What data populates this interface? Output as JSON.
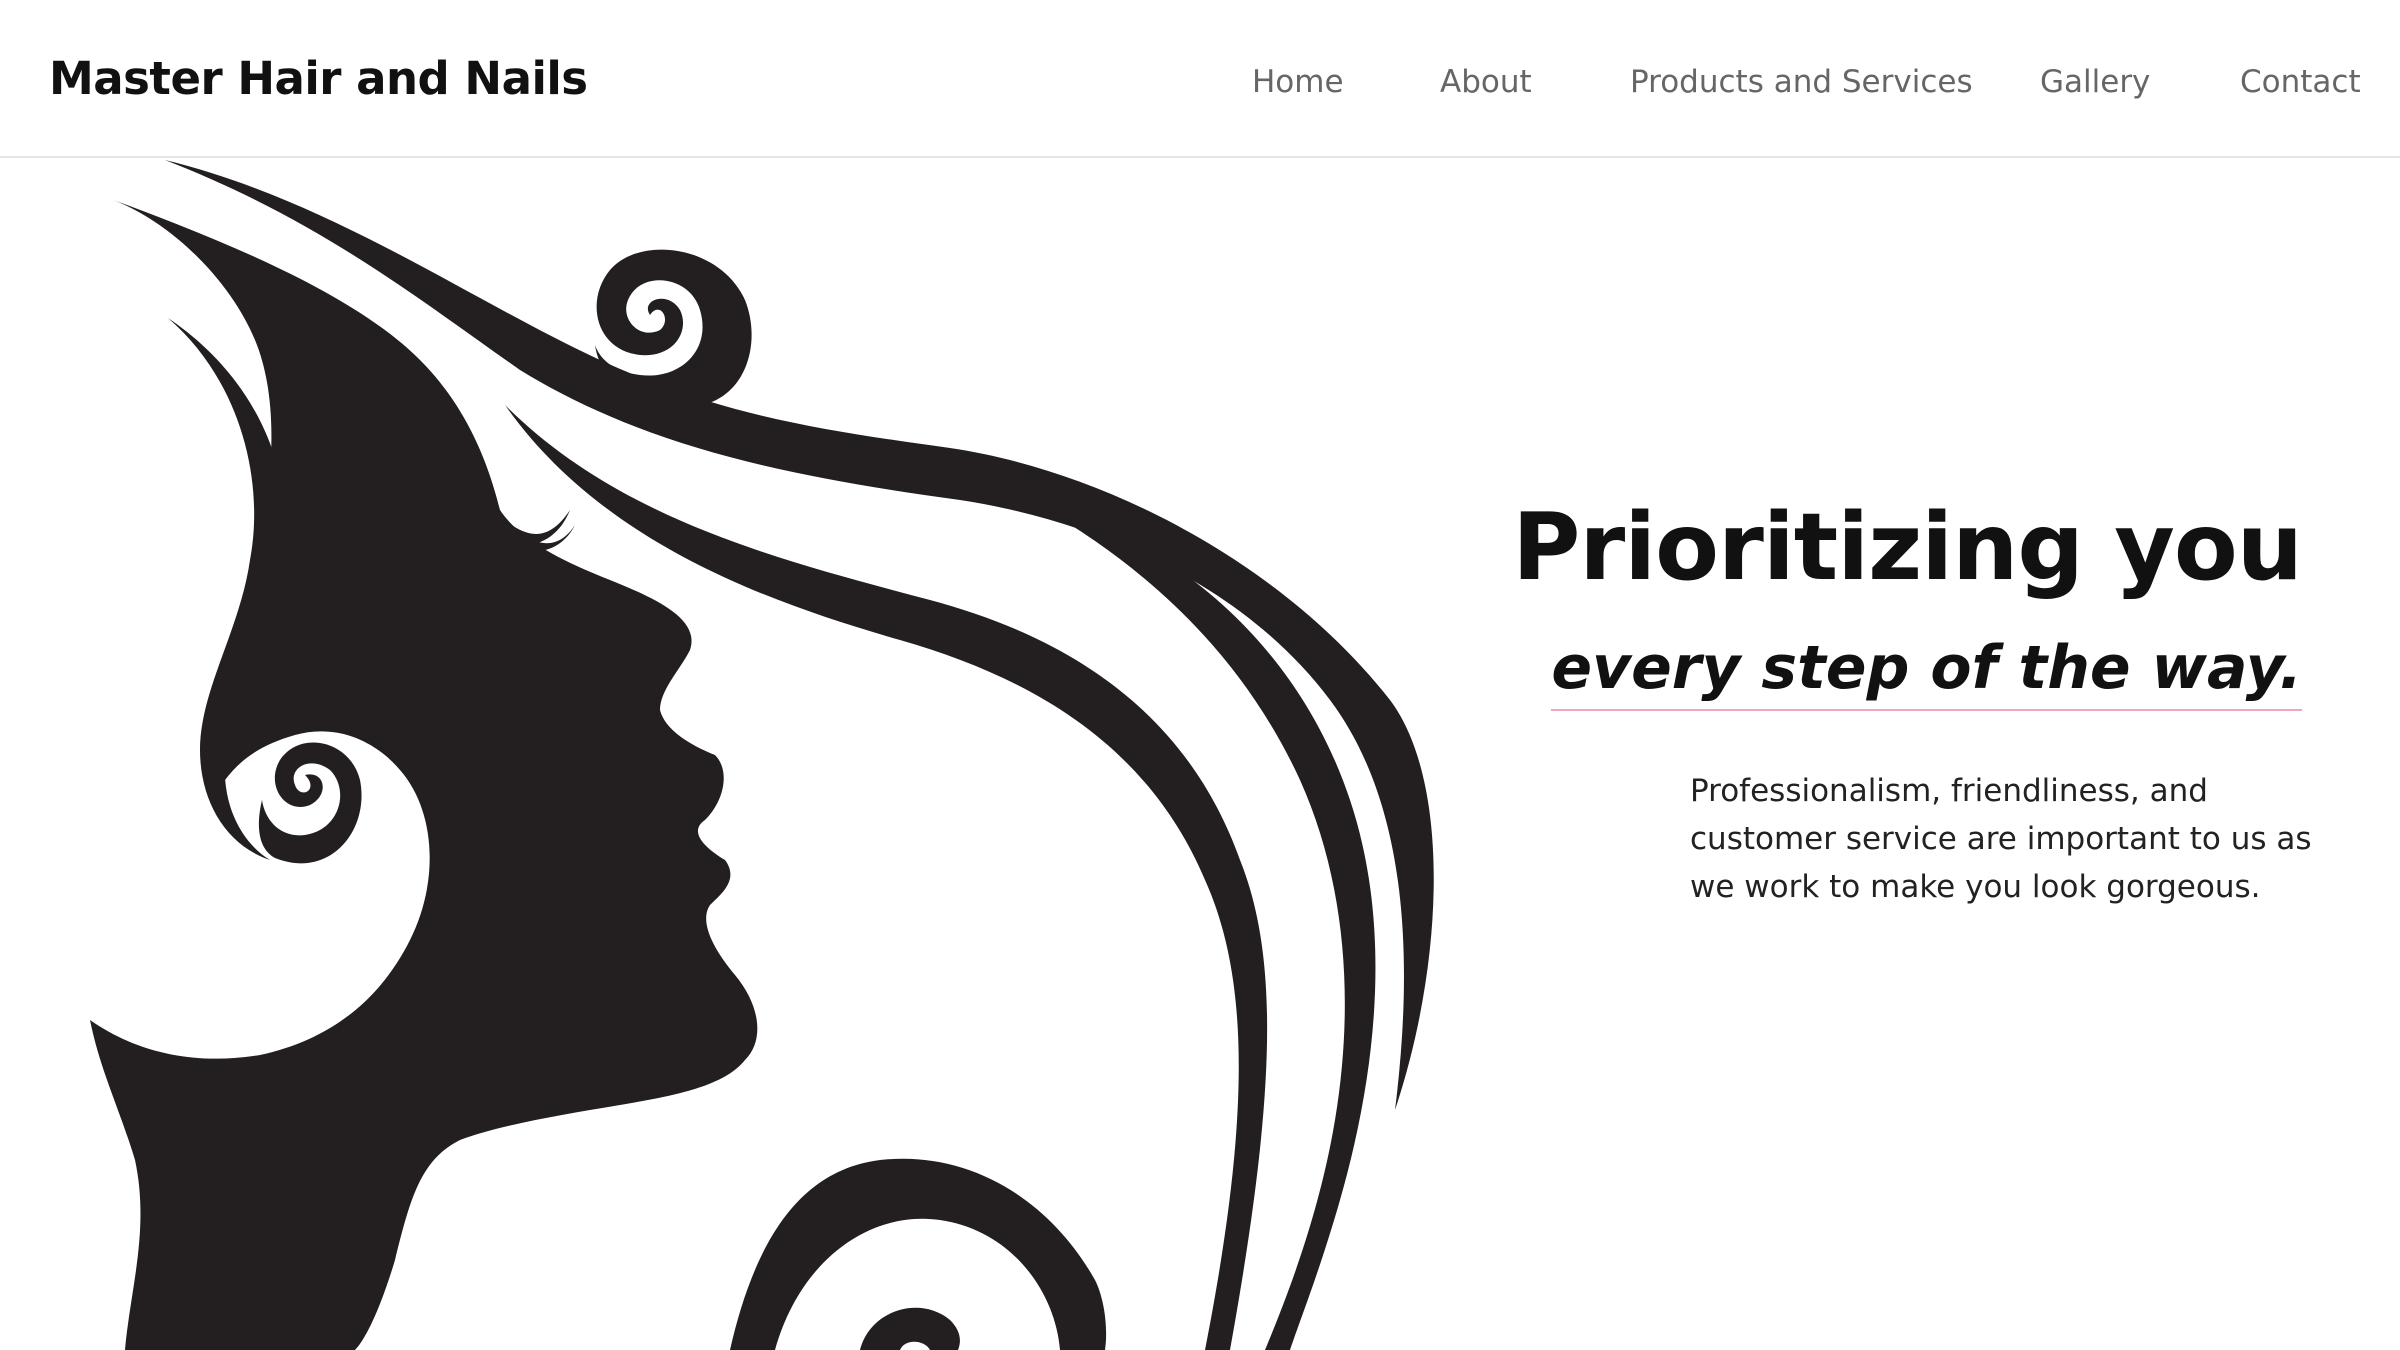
{
  "brand": {
    "name": "Master Hair and Nails"
  },
  "nav": {
    "items": [
      {
        "label": "Home"
      },
      {
        "label": "About"
      },
      {
        "label": "Products and Services"
      },
      {
        "label": "Gallery"
      },
      {
        "label": "Contact"
      }
    ]
  },
  "hero": {
    "image": "woman-silhouette-with-flowing-hair",
    "headline": "Prioritizing you",
    "tagline": "every step of the way.",
    "description": "Professionalism, friendliness, and customer service are important to us as we work to make you look gorgeous."
  },
  "colors": {
    "silhouette": "#231f20",
    "text": "#111111",
    "nav_link": "#666666",
    "tagline_underline": "#f1a7b8",
    "background": "#ffffff"
  }
}
